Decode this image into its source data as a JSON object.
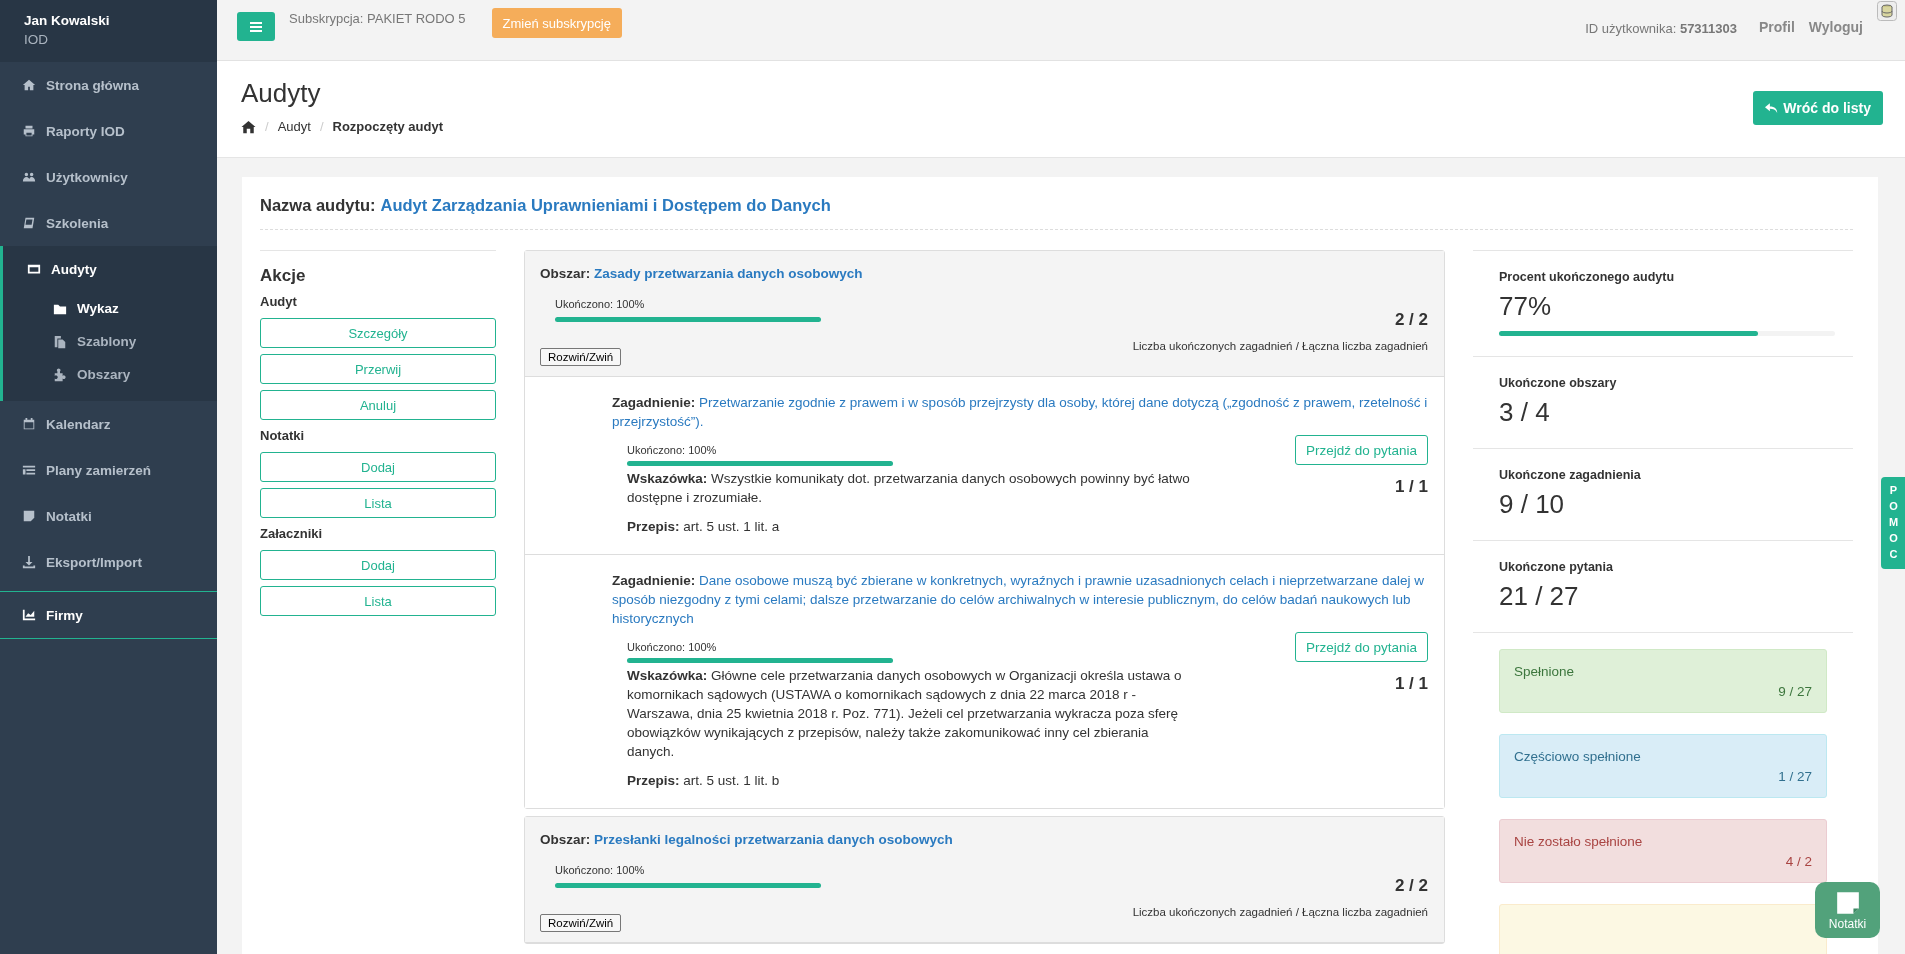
{
  "sidebar": {
    "user": {
      "name": "Jan Kowalski",
      "role": "IOD"
    },
    "items": [
      {
        "label": "Strona główna",
        "selected": false,
        "emphasized": false
      },
      {
        "label": "Raporty IOD",
        "selected": false,
        "emphasized": false
      },
      {
        "label": "Użytkownicy",
        "selected": false,
        "emphasized": false
      },
      {
        "label": "Szkolenia",
        "selected": false,
        "emphasized": false
      },
      {
        "label": "Audyty",
        "selected": true,
        "emphasized": false,
        "children": [
          {
            "label": "Wykaz",
            "selected": true
          },
          {
            "label": "Szablony",
            "selected": false
          },
          {
            "label": "Obszary",
            "selected": false
          }
        ]
      },
      {
        "label": "Kalendarz",
        "selected": false,
        "emphasized": false
      },
      {
        "label": "Plany zamierzeń",
        "selected": false,
        "emphasized": false
      },
      {
        "label": "Notatki",
        "selected": false,
        "emphasized": false
      },
      {
        "label": "Eksport/Import",
        "selected": false,
        "emphasized": false
      },
      {
        "label": "Firmy",
        "selected": false,
        "emphasized": true
      }
    ]
  },
  "topbar": {
    "subscription": "Subskrypcja: PAKIET RODO 5",
    "change_button": "Zmień subskrypcję",
    "user_id": "ID użytkownika: **57311303**",
    "links": [
      "Profil",
      "Wyloguj"
    ]
  },
  "header": {
    "title": "Audyty",
    "separator": "/",
    "breadcrumb": [
      {
        "label": "Audyt",
        "current": false
      },
      {
        "label": "Rozpoczęty audyt",
        "current": true
      }
    ],
    "back_button": "Wróć do listy"
  },
  "audit": {
    "name_label": "Nazwa audytu:",
    "name": "Audyt Zarządzania Uprawnieniami i Dostępem do Danych"
  },
  "actions": {
    "title": "Akcje",
    "groups": [
      {
        "label": "Audyt",
        "buttons": [
          "Szczegóły",
          "Przerwij",
          "Anuluj"
        ]
      },
      {
        "label": "Notatki",
        "buttons": [
          "Dodaj",
          "Lista"
        ]
      },
      {
        "label": "Załaczniki",
        "buttons": [
          "Dodaj",
          "Lista"
        ]
      }
    ]
  },
  "areas": [
    {
      "label": "Obszar:",
      "name": "Zasady przetwarzania danych osobowych",
      "progress_label": "Ukończono: 100%",
      "level": 1,
      "count": "2 / 2",
      "count_caption": "Liczba ukończonych zagadnień / Łączna liczba zagadnień",
      "toggle": "Rozwiń/Zwiń",
      "issues": [
        {
          "label": "Zagadnienie:",
          "name": "Przetwarzanie zgodnie z prawem i w sposób przejrzysty dla osoby, której dane dotyczą („zgodność z prawem, rzetelność i przejrzystość”).",
          "progress_label": "Ukończono: 100%",
          "level": 1,
          "hint_label": "Wskazówka:",
          "hint": "Wszystkie komunikaty dot. przetwarzania danych osobowych powinny być łatwo dostępne i zrozumiałe.",
          "rule_label": "Przepis:",
          "rule": "art. 5 ust. 1 lit. a",
          "button": "Przejdź do pytania",
          "count": "1 / 1"
        },
        {
          "label": "Zagadnienie:",
          "name": "Dane osobowe muszą być zbierane w konkretnych, wyraźnych i prawnie uzasadnionych celach i nieprzetwarzane dalej w sposób niezgodny z tymi celami; dalsze przetwarzanie do celów archiwalnych w interesie publicznym, do celów badań naukowych lub historycznych",
          "progress_label": "Ukończono: 100%",
          "level": 1,
          "hint_label": "Wskazówka:",
          "hint": "Główne cele przetwarzania danych osobowych w Organizacji określa ustawa o komornikach sądowych (USTAWA o komornikach sądowych z dnia 22 marca 2018 r - Warszawa, dnia 25 kwietnia 2018 r. Poz. 771). Jeżeli cel przetwarzania wykracza poza sferę obowiązków wynikających z przepisów, należy także zakomunikować inny cel zbierania danych.",
          "rule_label": "Przepis:",
          "rule": "art. 5 ust. 1 lit. b",
          "button": "Przejdź do pytania",
          "count": "1 / 1"
        }
      ]
    },
    {
      "label": "Obszar:",
      "name": "Przesłanki legalności przetwarzania danych osobowych",
      "progress_label": "Ukończono: 100%",
      "level": 1,
      "count": "2 / 2",
      "count_caption": "Liczba ukończonych zagadnień / Łączna liczba zagadnień",
      "toggle": "Rozwiń/Zwiń"
    }
  ],
  "stats": [
    {
      "label": "Procent ukończonego audytu",
      "value": "77%",
      "level": 0.77
    },
    {
      "label": "Ukończone obszary",
      "value": "3 / 4"
    },
    {
      "label": "Ukończone zagadnienia",
      "value": "9 / 10"
    },
    {
      "label": "Ukończone pytania",
      "value": "21 / 27"
    }
  ],
  "status_cards": [
    {
      "kind": "met",
      "label": "Spełnione",
      "count": "9 / 27"
    },
    {
      "kind": "partial",
      "label": "Częściowo spełnione",
      "count": "1 / 27"
    },
    {
      "kind": "unmet",
      "label": "Nie zostało spełnione",
      "count": "4 / 2"
    },
    {
      "kind": "na"
    }
  ],
  "help_tab": "POMOC",
  "notes_button": "Notatki"
}
